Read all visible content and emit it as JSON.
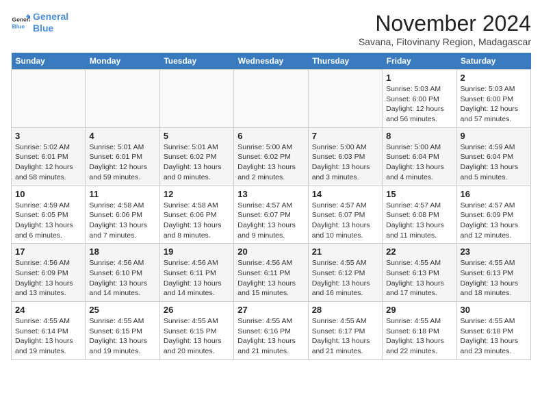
{
  "logo": {
    "line1": "General",
    "line2": "Blue"
  },
  "title": "November 2024",
  "location": "Savana, Fitovinany Region, Madagascar",
  "weekdays": [
    "Sunday",
    "Monday",
    "Tuesday",
    "Wednesday",
    "Thursday",
    "Friday",
    "Saturday"
  ],
  "weeks": [
    [
      {
        "day": "",
        "info": ""
      },
      {
        "day": "",
        "info": ""
      },
      {
        "day": "",
        "info": ""
      },
      {
        "day": "",
        "info": ""
      },
      {
        "day": "",
        "info": ""
      },
      {
        "day": "1",
        "info": "Sunrise: 5:03 AM\nSunset: 6:00 PM\nDaylight: 12 hours and 56 minutes."
      },
      {
        "day": "2",
        "info": "Sunrise: 5:03 AM\nSunset: 6:00 PM\nDaylight: 12 hours and 57 minutes."
      }
    ],
    [
      {
        "day": "3",
        "info": "Sunrise: 5:02 AM\nSunset: 6:01 PM\nDaylight: 12 hours and 58 minutes."
      },
      {
        "day": "4",
        "info": "Sunrise: 5:01 AM\nSunset: 6:01 PM\nDaylight: 12 hours and 59 minutes."
      },
      {
        "day": "5",
        "info": "Sunrise: 5:01 AM\nSunset: 6:02 PM\nDaylight: 13 hours and 0 minutes."
      },
      {
        "day": "6",
        "info": "Sunrise: 5:00 AM\nSunset: 6:02 PM\nDaylight: 13 hours and 2 minutes."
      },
      {
        "day": "7",
        "info": "Sunrise: 5:00 AM\nSunset: 6:03 PM\nDaylight: 13 hours and 3 minutes."
      },
      {
        "day": "8",
        "info": "Sunrise: 5:00 AM\nSunset: 6:04 PM\nDaylight: 13 hours and 4 minutes."
      },
      {
        "day": "9",
        "info": "Sunrise: 4:59 AM\nSunset: 6:04 PM\nDaylight: 13 hours and 5 minutes."
      }
    ],
    [
      {
        "day": "10",
        "info": "Sunrise: 4:59 AM\nSunset: 6:05 PM\nDaylight: 13 hours and 6 minutes."
      },
      {
        "day": "11",
        "info": "Sunrise: 4:58 AM\nSunset: 6:06 PM\nDaylight: 13 hours and 7 minutes."
      },
      {
        "day": "12",
        "info": "Sunrise: 4:58 AM\nSunset: 6:06 PM\nDaylight: 13 hours and 8 minutes."
      },
      {
        "day": "13",
        "info": "Sunrise: 4:57 AM\nSunset: 6:07 PM\nDaylight: 13 hours and 9 minutes."
      },
      {
        "day": "14",
        "info": "Sunrise: 4:57 AM\nSunset: 6:07 PM\nDaylight: 13 hours and 10 minutes."
      },
      {
        "day": "15",
        "info": "Sunrise: 4:57 AM\nSunset: 6:08 PM\nDaylight: 13 hours and 11 minutes."
      },
      {
        "day": "16",
        "info": "Sunrise: 4:57 AM\nSunset: 6:09 PM\nDaylight: 13 hours and 12 minutes."
      }
    ],
    [
      {
        "day": "17",
        "info": "Sunrise: 4:56 AM\nSunset: 6:09 PM\nDaylight: 13 hours and 13 minutes."
      },
      {
        "day": "18",
        "info": "Sunrise: 4:56 AM\nSunset: 6:10 PM\nDaylight: 13 hours and 14 minutes."
      },
      {
        "day": "19",
        "info": "Sunrise: 4:56 AM\nSunset: 6:11 PM\nDaylight: 13 hours and 14 minutes."
      },
      {
        "day": "20",
        "info": "Sunrise: 4:56 AM\nSunset: 6:11 PM\nDaylight: 13 hours and 15 minutes."
      },
      {
        "day": "21",
        "info": "Sunrise: 4:55 AM\nSunset: 6:12 PM\nDaylight: 13 hours and 16 minutes."
      },
      {
        "day": "22",
        "info": "Sunrise: 4:55 AM\nSunset: 6:13 PM\nDaylight: 13 hours and 17 minutes."
      },
      {
        "day": "23",
        "info": "Sunrise: 4:55 AM\nSunset: 6:13 PM\nDaylight: 13 hours and 18 minutes."
      }
    ],
    [
      {
        "day": "24",
        "info": "Sunrise: 4:55 AM\nSunset: 6:14 PM\nDaylight: 13 hours and 19 minutes."
      },
      {
        "day": "25",
        "info": "Sunrise: 4:55 AM\nSunset: 6:15 PM\nDaylight: 13 hours and 19 minutes."
      },
      {
        "day": "26",
        "info": "Sunrise: 4:55 AM\nSunset: 6:15 PM\nDaylight: 13 hours and 20 minutes."
      },
      {
        "day": "27",
        "info": "Sunrise: 4:55 AM\nSunset: 6:16 PM\nDaylight: 13 hours and 21 minutes."
      },
      {
        "day": "28",
        "info": "Sunrise: 4:55 AM\nSunset: 6:17 PM\nDaylight: 13 hours and 21 minutes."
      },
      {
        "day": "29",
        "info": "Sunrise: 4:55 AM\nSunset: 6:18 PM\nDaylight: 13 hours and 22 minutes."
      },
      {
        "day": "30",
        "info": "Sunrise: 4:55 AM\nSunset: 6:18 PM\nDaylight: 13 hours and 23 minutes."
      }
    ]
  ]
}
